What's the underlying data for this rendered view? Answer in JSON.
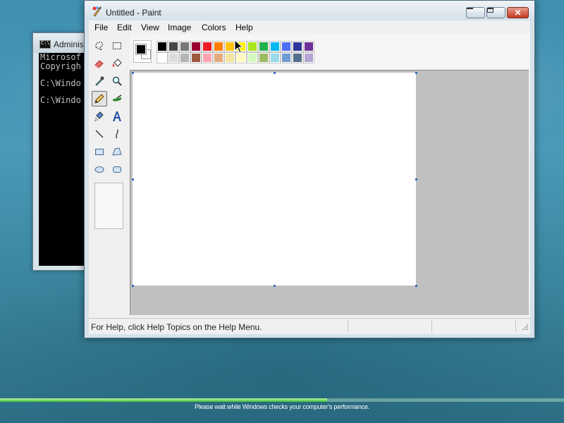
{
  "console": {
    "title": "Adminis",
    "lines": [
      "Microsof",
      "Copyrigh",
      "",
      "C:\\Windo",
      "",
      "C:\\Windo"
    ]
  },
  "paint": {
    "title": "Untitled - Paint",
    "menu": [
      "File",
      "Edit",
      "View",
      "Image",
      "Colors",
      "Help"
    ],
    "tools": [
      {
        "name": "free-form-select-icon"
      },
      {
        "name": "select-icon"
      },
      {
        "name": "eraser-icon"
      },
      {
        "name": "fill-with-color-icon"
      },
      {
        "name": "pick-color-icon"
      },
      {
        "name": "magnifier-icon"
      },
      {
        "name": "pencil-icon",
        "selected": true
      },
      {
        "name": "brush-icon"
      },
      {
        "name": "airbrush-icon"
      },
      {
        "name": "text-icon"
      },
      {
        "name": "line-icon"
      },
      {
        "name": "curve-icon"
      },
      {
        "name": "rectangle-icon"
      },
      {
        "name": "polygon-icon"
      },
      {
        "name": "ellipse-icon"
      },
      {
        "name": "rounded-rectangle-icon"
      }
    ],
    "current_colors": {
      "foreground": "#000000",
      "background": "#ffffff"
    },
    "palette_top": [
      "#000000",
      "#464646",
      "#787878",
      "#990030",
      "#ed1c24",
      "#ff7e00",
      "#ffc20e",
      "#fff200",
      "#a8e61d",
      "#22b14c",
      "#00b7ef",
      "#4d6df3",
      "#2f3699",
      "#6f3198"
    ],
    "palette_bottom": [
      "#ffffff",
      "#dcdcdc",
      "#b4b4b4",
      "#9c5a3c",
      "#ffa3b1",
      "#e5aa7a",
      "#f5e49c",
      "#fff9bd",
      "#d3f9bc",
      "#9dbb61",
      "#99d9ea",
      "#709ad1",
      "#546d8e",
      "#b5a5d5"
    ],
    "status": {
      "help_text": "For Help, click Help Topics on the Help Menu."
    }
  },
  "taskbar": {
    "progress_text": "Please wait while Windows checks your computer's performance.",
    "progress_fraction": 0.58
  }
}
